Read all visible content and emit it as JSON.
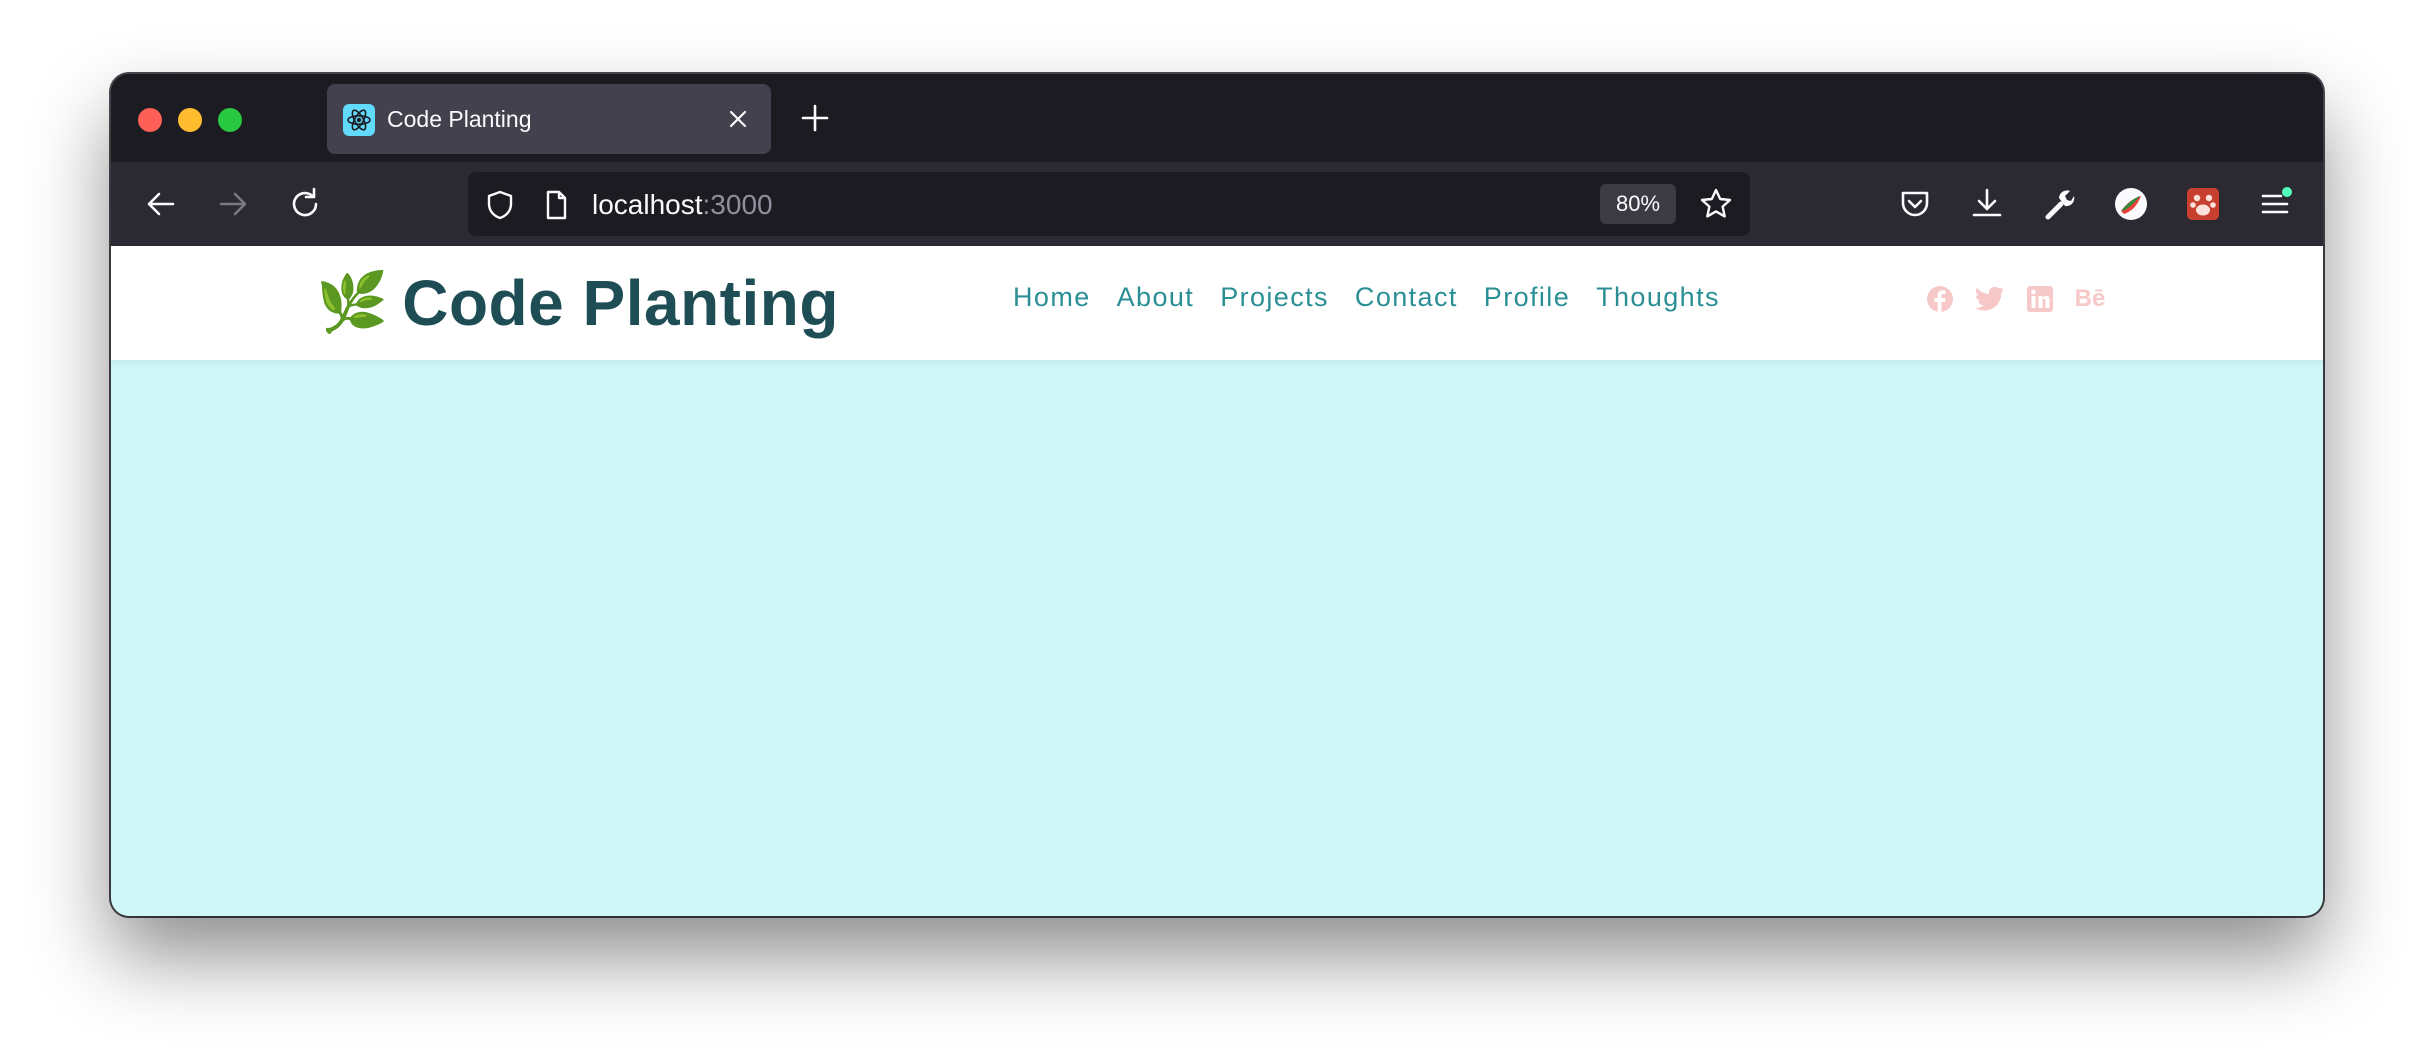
{
  "browser": {
    "tab": {
      "title": "Code Planting"
    },
    "url": {
      "host": "localhost",
      "port": ":3000"
    },
    "zoom": "80%"
  },
  "site": {
    "logo": {
      "emoji": "🌿",
      "text": "Code Planting"
    },
    "nav": [
      {
        "label": "Home"
      },
      {
        "label": "About"
      },
      {
        "label": "Projects"
      },
      {
        "label": "Contact"
      },
      {
        "label": "Profile"
      },
      {
        "label": "Thoughts"
      }
    ],
    "socials": [
      {
        "icon": "facebook-icon"
      },
      {
        "icon": "twitter-icon"
      },
      {
        "icon": "linkedin-icon"
      },
      {
        "icon": "behance-icon",
        "glyph": "Bē"
      }
    ],
    "colors": {
      "logo_text": "#1e4d55",
      "nav_link": "#2a8f95",
      "page_background": "#cff7f8",
      "social_icon": "#f6c8c8"
    }
  }
}
